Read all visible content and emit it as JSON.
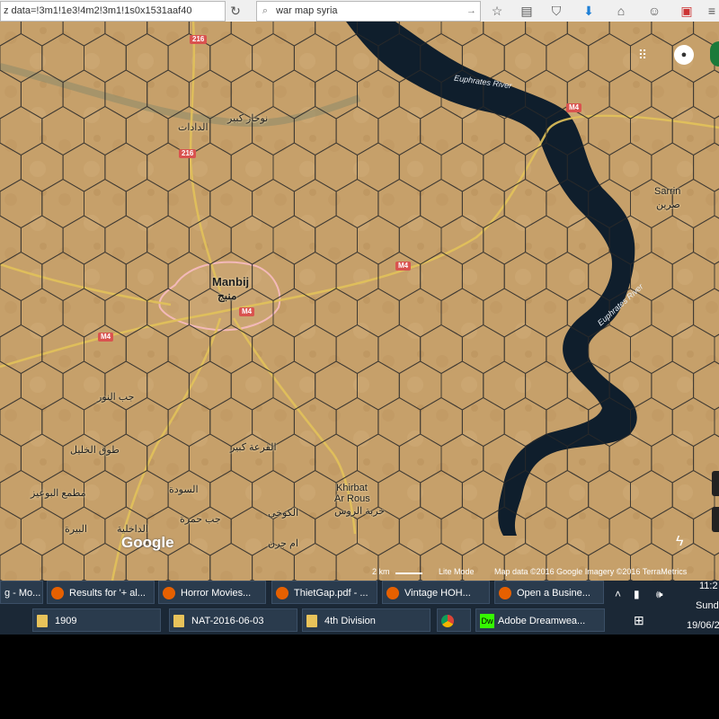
{
  "browser": {
    "url_text": "z data=!3m1!1e3!4m2!3m1!1s0x1531aaf40",
    "search_text": "war map syria"
  },
  "map": {
    "places": {
      "manbij": "Manbij",
      "manbij_ar": "منبج",
      "sarrin": "Sarrin",
      "sarrin_ar": "صرين",
      "khirbat": "Khirbat",
      "ar_rous": "Ar Rous",
      "khirbat_ar": "خربة الروس",
      "nohkhar_kabir": "نوخار كبير",
      "aldadat": "الدادات",
      "jeb_alnour": "جب النور",
      "tuq_alkhalil": "طوق الخليل",
      "mutaa_albuaiz": "مطمع البوعيز",
      "albira": "البيرة",
      "aldakhila": "الداخلية",
      "jeb_hamra": "جب حمرة",
      "alsouda": "السودة",
      "alqaraa_kabir": "القرعة كبير",
      "alkoukhi": "الكوخي",
      "amjarn": "ام جرن"
    },
    "rivers": {
      "euphrates_1": "Euphrates River",
      "euphrates_2": "Euphrates River"
    },
    "roads": {
      "r216_a": "216",
      "r216_b": "216",
      "m4_a": "M4",
      "m4_b": "M4",
      "m4_c": "M4",
      "m4_d": "M4"
    },
    "google_logo": "Google",
    "attribution": {
      "scale": "2 km",
      "mode": "Lite Mode",
      "data": "Map data ©2016 Google Imagery ©2016 TerraMetrics"
    }
  },
  "taskbar": {
    "row1": [
      "g - Mo...",
      "Results for '+ al...",
      "Horror Movies...",
      "ThietGap.pdf - ...",
      "Vintage HOH...",
      "Open a Busine..."
    ],
    "row2": [
      "1909",
      "NAT-2016-06-03",
      "4th Division",
      "",
      "Adobe Dreamwea..."
    ],
    "clock_time": "11:2",
    "clock_day": "Sund",
    "clock_date": "19/06/2"
  },
  "colors": {
    "terrain": "#c6a06a",
    "water": "#0f1e2c",
    "hex_grid": "#2a2a2a",
    "taskbar": "#1b2836",
    "road_shield": "#d9534f"
  }
}
